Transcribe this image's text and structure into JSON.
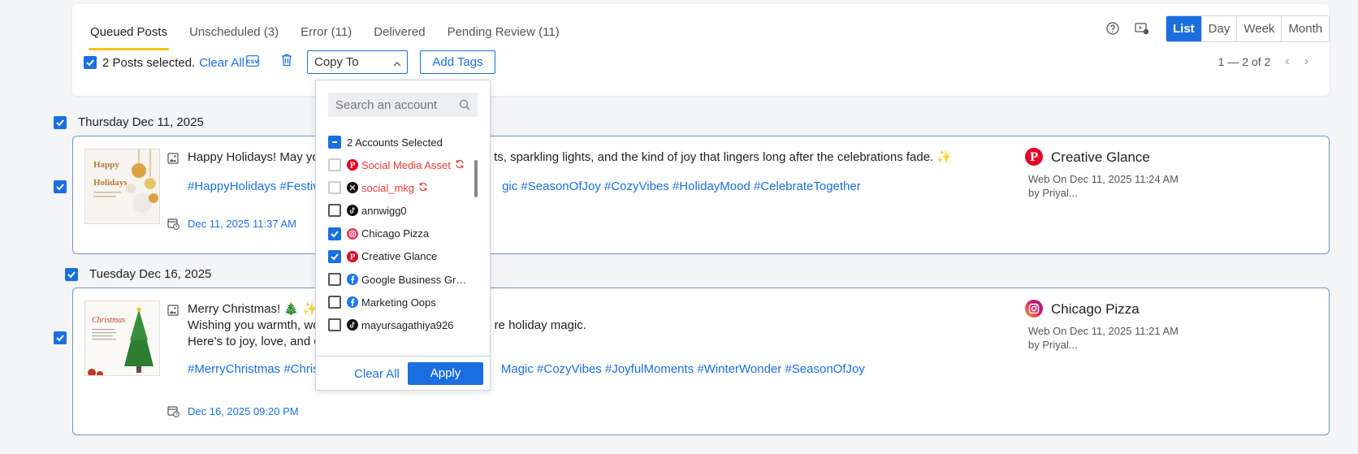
{
  "tabs": [
    {
      "label": "Queued Posts"
    },
    {
      "label": "Unscheduled (3)"
    },
    {
      "label": "Error (11)"
    },
    {
      "label": "Delivered"
    },
    {
      "label": "Pending Review (11)"
    }
  ],
  "views": [
    {
      "label": "List"
    },
    {
      "label": "Day"
    },
    {
      "label": "Week"
    },
    {
      "label": "Month"
    }
  ],
  "selection": {
    "text": "2 Posts selected.",
    "clear_label": "Clear All"
  },
  "copy_to": {
    "label": "Copy To"
  },
  "add_tags": {
    "label": "Add Tags"
  },
  "pager": {
    "text": "1 — 2 of 2"
  },
  "days": [
    {
      "label": "Thursday Dec 11, 2025"
    },
    {
      "label": "Tuesday Dec 16, 2025"
    }
  ],
  "posts": [
    {
      "text_line1": "Happy Holidays! May you",
      "text_tail": "ts, sparkling lights, and the kind of joy that lingers long after the celebrations fade. ✨",
      "hashtags_head": "#HappyHolidays #Festive",
      "hashtags_tail": "gic #SeasonOfJoy #CozyVibes #HolidayMood #CelebrateTogether",
      "scheduled": "Dec 11, 2025 11:37 AM",
      "account": "Creative Glance",
      "meta1": "Web On Dec 11, 2025 11:24 AM",
      "meta2": "by Priyal...",
      "thumb_title": "Happy Holidays"
    },
    {
      "text_line1": "Merry Christmas! 🎄 ✨",
      "text_line2_head": "Wishing you warmth, wor",
      "text_line2_tail": "re holiday magic.",
      "text_line3_head": "Here’s to joy, love, and co",
      "hashtags_head": "#MerryChristmas #Christr",
      "hashtags_tail": "Magic #CozyVibes #JoyfulMoments #WinterWonder #SeasonOfJoy",
      "scheduled": "Dec 16, 2025 09:20 PM",
      "account": "Chicago Pizza",
      "meta1": "Web On Dec 11, 2025 11:21 AM",
      "meta2": "by Priyal...",
      "thumb_title": "Merry Christmas"
    }
  ],
  "dropdown": {
    "search_placeholder": "Search an account",
    "selected_summary": "2 Accounts Selected",
    "accounts": [
      {
        "name": "Social Media Asset",
        "network": "pinterest",
        "checked": false,
        "error": true
      },
      {
        "name": "social_mkg",
        "network": "x",
        "checked": false,
        "error": true
      },
      {
        "name": "annwigg0",
        "network": "tiktok",
        "checked": false,
        "error": false
      },
      {
        "name": "Chicago Pizza",
        "network": "instagram",
        "checked": true,
        "error": false
      },
      {
        "name": "Creative Glance",
        "network": "pinterest",
        "checked": true,
        "error": false
      },
      {
        "name": "Google Business Gr…",
        "network": "facebook",
        "checked": false,
        "error": false
      },
      {
        "name": "Marketing Oops",
        "network": "facebook",
        "checked": false,
        "error": false
      },
      {
        "name": "mayursagathiya926",
        "network": "tiktok",
        "checked": false,
        "error": false
      }
    ],
    "clear_label": "Clear All",
    "apply_label": "Apply"
  },
  "colors": {
    "accent": "#1a6fe0",
    "error": "#e53935",
    "tab_underline": "#f5c518"
  }
}
